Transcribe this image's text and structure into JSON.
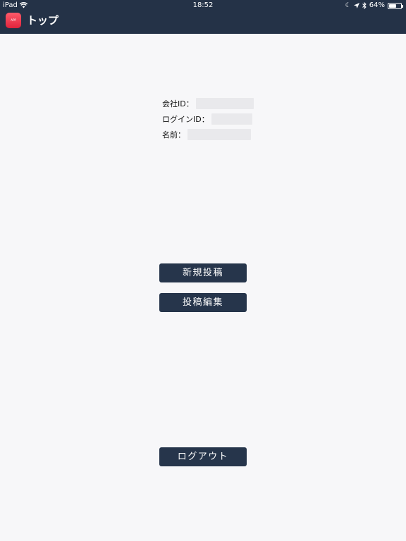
{
  "status_bar": {
    "carrier": "iPad",
    "time": "18:52",
    "battery_percent": "64%",
    "battery_level": 0.64,
    "icons": [
      "wifi-icon",
      "moon-icon",
      "location-arrow-icon",
      "bluetooth-icon",
      "battery-icon"
    ]
  },
  "nav": {
    "title": "トップ",
    "app_icon": "app-logo-icon"
  },
  "user_info": {
    "company_id_label": "会社ID：",
    "login_id_label": "ログインID：",
    "name_label": "名前："
  },
  "actions": {
    "new_post": "新規投稿",
    "edit_post": "投稿編集",
    "logout": "ログアウト"
  },
  "colors": {
    "header_bg": "#243247",
    "button_bg": "#26354b",
    "page_bg": "#f7f7f9"
  }
}
